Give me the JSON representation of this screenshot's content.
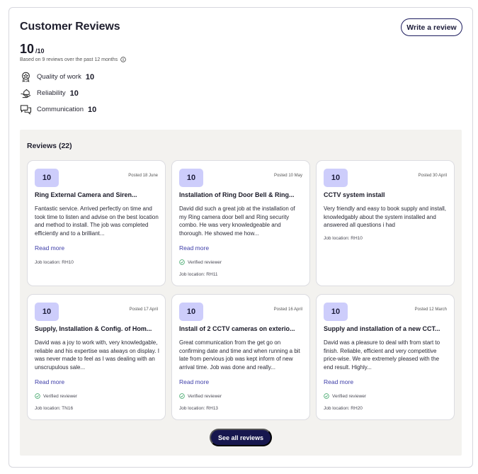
{
  "header": {
    "title": "Customer Reviews",
    "write_review_label": "Write a review"
  },
  "summary": {
    "score": "10",
    "score_den": "/10",
    "based_on": "Based on 9 reviews over the past 12 months"
  },
  "metrics": [
    {
      "label": "Quality of work",
      "value": "10",
      "icon": "award-badge-icon"
    },
    {
      "label": "Reliability",
      "value": "10",
      "icon": "hand-house-icon"
    },
    {
      "label": "Communication",
      "value": "10",
      "icon": "chat-bubbles-icon"
    }
  ],
  "reviews": {
    "heading": "Reviews (22)",
    "read_more_label": "Read more",
    "verified_label": "Verified reviewer",
    "see_all_label": "See all reviews",
    "cards": [
      {
        "score": "10",
        "posted": "Posted 18 June",
        "title": "Ring External Camera and Siren...",
        "body": "Fantastic service. Arrived perfectly on time and took time to listen and advise on the best location and method to install. The job was completed efficiently and to a brilliant...",
        "verified": false,
        "location": "Job location: RH10"
      },
      {
        "score": "10",
        "posted": "Posted 10 May",
        "title": "Installation of Ring Door Bell & Ring...",
        "body": "David did such a great job at the installation of my Ring camera door bell and Ring security combo. He was very knowledgeable and thorough. He showed me how...",
        "verified": true,
        "location": "Job location: RH11"
      },
      {
        "score": "10",
        "posted": "Posted 30 April",
        "title": "CCTV system install",
        "body": "Very friendly and easy to book supply and install, knowledgably about the system installed and answered all questions i had",
        "verified": false,
        "location": "Job location: RH10"
      },
      {
        "score": "10",
        "posted": "Posted 17 April",
        "title": "Supply, Installation & Config. of Hom...",
        "body": "David was a joy to work with, very knowledgable, reliable and his expertise was always on display. I was never made to feel as I was dealing with an unscrupulous sale...",
        "verified": true,
        "location": "Job location: TN16"
      },
      {
        "score": "10",
        "posted": "Posted 16 April",
        "title": "Install of 2 CCTV cameras on exterio...",
        "body": "Great communication from the get go on confirming date and time and when running a bit late from pervious job was kept inform of new arrival time. Job was done and really...",
        "verified": true,
        "location": "Job location: RH13"
      },
      {
        "score": "10",
        "posted": "Posted 12 March",
        "title": "Supply and installation of a new CCT...",
        "body": "David was a pleasure to deal with from start to finish. Reliable, efficient and very competitive price-wise. We are extremely pleased with the end result. Highly...",
        "verified": true,
        "location": "Job location: RH20"
      }
    ]
  }
}
